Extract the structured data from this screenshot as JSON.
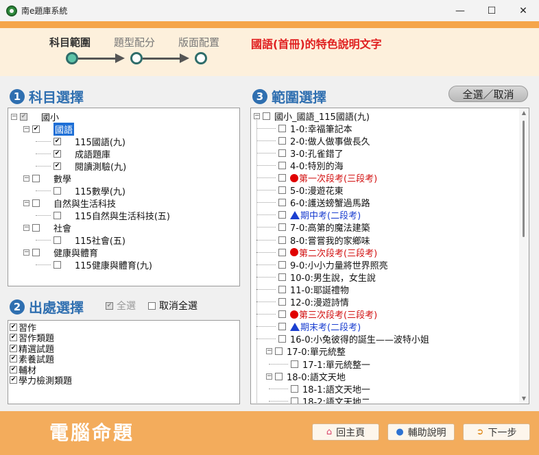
{
  "window": {
    "title": "南e題庫系統",
    "minimize": "—",
    "maximize": "☐",
    "close": "✕"
  },
  "steps": [
    {
      "label": "科目範圍",
      "active": true
    },
    {
      "label": "題型配分",
      "active": false
    },
    {
      "label": "版面配置",
      "active": false
    }
  ],
  "header_title": "國語(首冊)的特色說明文字",
  "subject_section": {
    "number": "1",
    "title": "科目選擇",
    "tree": [
      {
        "label": "國小",
        "level": 0,
        "expander": "−",
        "check": "partial"
      },
      {
        "label": "國語",
        "level": 1,
        "expander": "−",
        "check": "checked",
        "selected": true
      },
      {
        "label": "115國語(九)",
        "level": 2,
        "check": "checked"
      },
      {
        "label": "成語題庫",
        "level": 2,
        "check": "checked"
      },
      {
        "label": "閱讀測驗(九)",
        "level": 2,
        "check": "checked"
      },
      {
        "label": "數學",
        "level": 1,
        "expander": "−",
        "check": "none"
      },
      {
        "label": "115數學(九)",
        "level": 2,
        "check": "none"
      },
      {
        "label": "自然與生活科技",
        "level": 1,
        "expander": "−",
        "check": "none"
      },
      {
        "label": "115自然與生活科技(五)",
        "level": 2,
        "check": "none"
      },
      {
        "label": "社會",
        "level": 1,
        "expander": "−",
        "check": "none"
      },
      {
        "label": "115社會(五)",
        "level": 2,
        "check": "none"
      },
      {
        "label": "健康與體育",
        "level": 1,
        "expander": "−",
        "check": "none"
      },
      {
        "label": "115健康與體育(九)",
        "level": 2,
        "check": "none"
      }
    ]
  },
  "source_section": {
    "number": "2",
    "title": "出處選擇",
    "select_all": "全選",
    "deselect_all": "取消全選",
    "items": [
      "習作",
      "習作類題",
      "精選試題",
      "素養試題",
      "輔材",
      "學力檢測類題"
    ]
  },
  "range_section": {
    "number": "3",
    "title": "範圍選擇",
    "toggle_button": "全選／取消",
    "root": "國小_國語_115國語(九)",
    "items": [
      {
        "label": "1-0:幸福筆記本",
        "level": 1
      },
      {
        "label": "2-0:做人做事做長久",
        "level": 1
      },
      {
        "label": "3-0:孔雀錯了",
        "level": 1
      },
      {
        "label": "4-0:特別的海",
        "level": 1
      },
      {
        "label": "第一次段考(三段考)",
        "level": 1,
        "marker": "red"
      },
      {
        "label": "5-0:漫遊花東",
        "level": 1
      },
      {
        "label": "6-0:護送螃蟹過馬路",
        "level": 1
      },
      {
        "label": "期中考(二段考)",
        "level": 1,
        "marker": "blue"
      },
      {
        "label": "7-0:高第的魔法建築",
        "level": 1
      },
      {
        "label": "8-0:嘗嘗我的家鄉味",
        "level": 1
      },
      {
        "label": "第二次段考(三段考)",
        "level": 1,
        "marker": "red"
      },
      {
        "label": "9-0:小小力量將世界照亮",
        "level": 1
      },
      {
        "label": "10-0:男生說，女生說",
        "level": 1
      },
      {
        "label": "11-0:耶誕禮物",
        "level": 1
      },
      {
        "label": "12-0:漫遊詩情",
        "level": 1
      },
      {
        "label": "第三次段考(三段考)",
        "level": 1,
        "marker": "red"
      },
      {
        "label": "期末考(二段考)",
        "level": 1,
        "marker": "blue"
      },
      {
        "label": "16-0:小兔彼得的誕生——波特小姐",
        "level": 1
      },
      {
        "label": "17-0:單元統整",
        "level": 1,
        "expander": "−"
      },
      {
        "label": "17-1:單元統整一",
        "level": 2
      },
      {
        "label": "18-0:語文天地",
        "level": 1,
        "expander": "−"
      },
      {
        "label": "18-1:語文天地一",
        "level": 2
      },
      {
        "label": "18-2:語文天地二",
        "level": 2
      }
    ]
  },
  "footer": {
    "title": "電腦命題",
    "home": "回主頁",
    "help": "輔助說明",
    "next": "下一步"
  },
  "colors": {
    "accent_orange": "#f3ac5c",
    "section_blue": "#2f6fb0",
    "header_red": "#e02020"
  }
}
